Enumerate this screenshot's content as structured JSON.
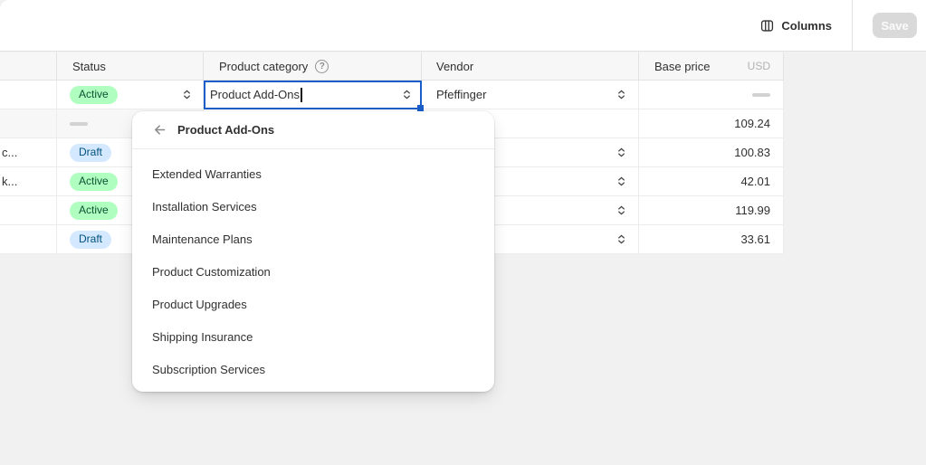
{
  "topbar": {
    "columns_label": "Columns",
    "save_label": "Save"
  },
  "table": {
    "headers": {
      "name": "",
      "status": "Status",
      "category": "Product category",
      "vendor": "Vendor",
      "price": "Base price",
      "currency": "USD"
    },
    "rows": [
      {
        "name": "",
        "shaded": false,
        "status": {
          "type": "badge",
          "label": "Active",
          "tone": "success"
        },
        "category": {
          "value": "Product Add-Ons",
          "focused": true,
          "caret": true
        },
        "vendor": {
          "value": "Pfeffinger",
          "caret": true
        },
        "price": {
          "dash": true
        }
      },
      {
        "name": "",
        "shaded": true,
        "status": {
          "type": "dash"
        },
        "category": {},
        "vendor": {},
        "price": {
          "value": "109.24"
        }
      },
      {
        "name": "c...",
        "shaded": false,
        "status": {
          "type": "badge",
          "label": "Draft",
          "tone": "info"
        },
        "category": {},
        "vendor": {
          "caret": true
        },
        "price": {
          "value": "100.83"
        }
      },
      {
        "name": "k...",
        "shaded": false,
        "status": {
          "type": "badge",
          "label": "Active",
          "tone": "success"
        },
        "category": {},
        "vendor": {
          "caret": true
        },
        "price": {
          "value": "42.01"
        }
      },
      {
        "name": "",
        "shaded": false,
        "status": {
          "type": "badge",
          "label": "Active",
          "tone": "success"
        },
        "category": {},
        "vendor": {
          "caret": true
        },
        "price": {
          "value": "119.99"
        }
      },
      {
        "name": "",
        "shaded": false,
        "status": {
          "type": "badge",
          "label": "Draft",
          "tone": "info"
        },
        "category": {},
        "vendor": {
          "caret": true
        },
        "price": {
          "value": "33.61"
        }
      }
    ]
  },
  "popover": {
    "title": "Product Add-Ons",
    "items": [
      "Extended Warranties",
      "Installation Services",
      "Maintenance Plans",
      "Product Customization",
      "Product Upgrades",
      "Shipping Insurance",
      "Subscription Services"
    ]
  },
  "colors": {
    "focus": "#1b5ec9",
    "badge_success_bg": "#b1fec1",
    "badge_success_text": "#0c5132",
    "badge_info_bg": "#d4e9ff",
    "badge_info_text": "#00527c",
    "page_bg": "#f1f1f1"
  }
}
